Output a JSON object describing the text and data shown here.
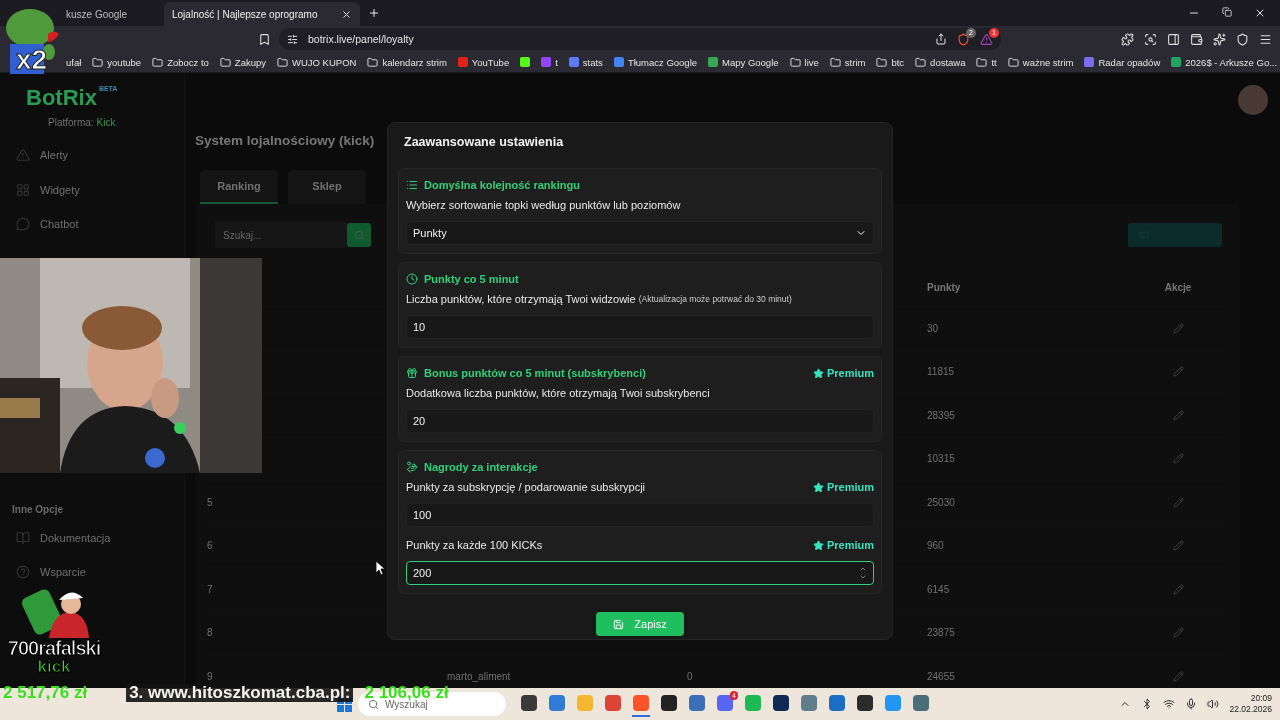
{
  "browser": {
    "tabs": [
      {
        "title": "kusze Google",
        "selected": false
      },
      {
        "title": "Lojalność | Najlepsze oprogramo",
        "selected": true
      }
    ],
    "address": "botrix.live/panel/loyalty",
    "shield_badge": "2",
    "alert_badge": "1",
    "bookmarks": [
      {
        "kind": "text",
        "label": "ufał"
      },
      {
        "kind": "folder",
        "label": "youtube"
      },
      {
        "kind": "folder",
        "label": "Zobocz to"
      },
      {
        "kind": "folder",
        "label": "Zakupy"
      },
      {
        "kind": "folder",
        "label": "WUJO KUPON"
      },
      {
        "kind": "folder",
        "label": "kalendarz strim"
      },
      {
        "kind": "site",
        "label": "YouTube",
        "color": "#e62117"
      },
      {
        "kind": "site",
        "color": "#53fc18"
      },
      {
        "kind": "site",
        "label": "t",
        "color": "#9146ff"
      },
      {
        "kind": "site",
        "label": "stats",
        "color": "#5b7cfa"
      },
      {
        "kind": "site",
        "label": "Tłumacz Google",
        "color": "#4285f4"
      },
      {
        "kind": "site",
        "label": "Mapy Google",
        "color": "#34a853"
      },
      {
        "kind": "folder",
        "label": "live"
      },
      {
        "kind": "folder",
        "label": "strim"
      },
      {
        "kind": "folder",
        "label": "btc"
      },
      {
        "kind": "folder",
        "label": "dostawa"
      },
      {
        "kind": "folder",
        "label": "tt"
      },
      {
        "kind": "folder",
        "label": "ważne strim"
      },
      {
        "kind": "site",
        "label": "Radar opadów",
        "color": "#7b6cf0"
      },
      {
        "kind": "site",
        "label": "2026$ - Arkusze Go...",
        "color": "#1fa463"
      }
    ]
  },
  "page": {
    "logo": "BotRix",
    "logo_badge": "BETA",
    "platform_label": "Platforma:",
    "platform": "Kick",
    "nav": [
      {
        "kind": "alert",
        "label": "Alerty"
      },
      {
        "kind": "grid",
        "label": "Widgety"
      },
      {
        "kind": "chat",
        "label": "Chatbot"
      }
    ],
    "section_heading": "Inne Opcje",
    "nav_more": [
      {
        "kind": "book",
        "label": "Dokumentacja"
      },
      {
        "kind": "help",
        "label": "Wsparcie"
      }
    ],
    "title": "System lojalnościowy (kick)",
    "tabs": [
      {
        "label": "Ranking",
        "selected": true
      },
      {
        "label": "Sklep",
        "selected": false
      }
    ],
    "search": {
      "placeholder": "Szukaj..."
    },
    "table": {
      "columns": [
        "Punkty",
        "Akcje"
      ],
      "rows": [
        {
          "points": "30"
        },
        {
          "points": "11815"
        },
        {
          "points": "28395"
        },
        {
          "points": "10315"
        },
        {
          "rank": "5",
          "points": "25030"
        },
        {
          "rank": "6",
          "points": "960"
        },
        {
          "rank": "7",
          "points": "6145"
        },
        {
          "rank": "8",
          "points": "23875"
        },
        {
          "rank": "9",
          "name": "marto_aliment",
          "column_3": "0",
          "points": "24655"
        }
      ]
    }
  },
  "modal": {
    "title": "Zaawansowane ustawienia",
    "save": "Zapisz",
    "sections": [
      {
        "kind": "list",
        "title": "Domyślna kolejność rankingu",
        "fields": [
          {
            "kind": "select",
            "label": "Wybierz sortowanie topki według punktów lub poziomów",
            "value": "Punkty",
            "focused": false
          }
        ]
      },
      {
        "kind": "clock",
        "title": "Punkty co 5 minut",
        "fields": [
          {
            "kind": "number",
            "label": "Liczba punktów, które otrzymają Twoi widzowie",
            "note": "(Aktualizacja może potrwać do 30 minut)",
            "value": "10",
            "focused": false
          }
        ]
      },
      {
        "kind": "gift",
        "title": "Bonus punktów co 5 minut (subskrybenci)",
        "premium_label": "Premium",
        "fields": [
          {
            "kind": "number",
            "label": "Dodatkowa liczba punktów, które otrzymają Twoi subskrybenci",
            "value": "20",
            "focused": false
          }
        ]
      },
      {
        "kind": "hand",
        "title": "Nagrody za interakcje",
        "fields": [
          {
            "kind": "number",
            "label": "Punkty za subskrypcję / podarowanie subskrypcji",
            "value": "100",
            "premium_label": "Premium",
            "focused": false
          },
          {
            "kind": "number",
            "label": "Punkty za każde 100 KICKs",
            "value": "200",
            "premium_label": "Premium",
            "focused": true
          }
        ]
      }
    ]
  },
  "stream": {
    "emote_text": "x2",
    "logo_name": "700rafalski",
    "logo_platform": "kick",
    "ticker": [
      {
        "kind": "amount",
        "text": "2 517,76 zł"
      },
      {
        "kind": "site",
        "text": "3. www.hitoszkomat.cba.pl:"
      },
      {
        "kind": "amount",
        "text": "2 106,06 zł"
      }
    ]
  },
  "taskbar": {
    "search": {
      "placeholder": "Wyszukaj"
    },
    "apps": [
      {
        "color": "#3a3a3a",
        "selected": false
      },
      {
        "color": "#2f7bd8",
        "selected": false
      },
      {
        "color": "#f3b730",
        "selected": false
      },
      {
        "color": "#db4437",
        "selected": false
      },
      {
        "color": "#fb542b",
        "selected": true
      },
      {
        "color": "#222222",
        "selected": false
      },
      {
        "color": "#3b6fb8",
        "selected": false
      },
      {
        "color": "#5865f2",
        "selected": false,
        "badge": "4"
      },
      {
        "color": "#1db954",
        "selected": false
      },
      {
        "color": "#0e2a55",
        "selected": false
      },
      {
        "color": "#607d8b",
        "selected": false
      },
      {
        "color": "#1a6fc4",
        "selected": false
      },
      {
        "color": "#2b2b2b",
        "selected": false
      },
      {
        "color": "#2196f3",
        "selected": false
      },
      {
        "color": "#4a6f7a",
        "selected": false
      }
    ],
    "time": "20:09",
    "date": "22.02.2026"
  }
}
